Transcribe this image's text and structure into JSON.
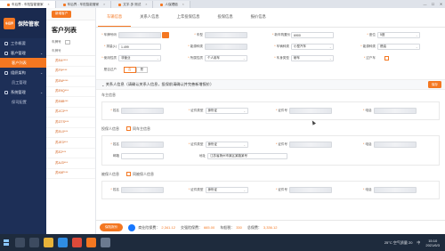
{
  "browser": {
    "tabs": [
      {
        "label": "车后界 - 车险智能管家",
        "active": true
      },
      {
        "label": "车后界 - 车险智能管家",
        "active": false
      },
      {
        "label": "文字-多 测试",
        "active": false
      },
      {
        "label": "人保理赔",
        "active": false
      }
    ],
    "window_controls": [
      "—",
      "☐",
      "✕"
    ]
  },
  "app": {
    "logo_mark": "车后界",
    "logo_text": "保险管家",
    "accent": "#f47721",
    "sidebar_bg": "#1d2f57"
  },
  "sidebar": {
    "items": [
      {
        "label": "工作概要",
        "type": "item"
      },
      {
        "label": "客户管理",
        "type": "group"
      },
      {
        "label": "客户列表",
        "type": "sub",
        "active": true
      },
      {
        "label": "组织架构",
        "type": "group"
      },
      {
        "label": "员工管理",
        "type": "sub"
      },
      {
        "label": "系统管理",
        "type": "group"
      },
      {
        "label": "保司配置",
        "type": "sub"
      }
    ]
  },
  "list": {
    "add_button": "新增客户",
    "title": "客户列表",
    "filter_label": "车牌号",
    "column_header": "车牌号",
    "plates": [
      "苏EA****",
      "苏F9****",
      "苏EM****",
      "苏E9Q***",
      "苏E8B***",
      "苏JC3***",
      "苏GTS***",
      "苏EL0***",
      "苏JE3***",
      "苏E2***",
      "苏AJ3***",
      "苏K6F***"
    ]
  },
  "detail": {
    "tabs": [
      {
        "label": "车辆信息",
        "active": true
      },
      {
        "label": "关系人信息",
        "active": false
      },
      {
        "label": "上年投保信息",
        "active": false
      },
      {
        "label": "投保信息",
        "active": false
      },
      {
        "label": "报价信息",
        "active": false
      }
    ],
    "vehicle_rows": [
      [
        {
          "label": "车牌号码",
          "req": true,
          "value": "",
          "blur": true,
          "action": true
        },
        {
          "label": "车型",
          "req": true,
          "value": "",
          "blur": true
        },
        {
          "label": "新车购置价",
          "req": true,
          "value": "6900",
          "blur": false
        },
        {
          "label": "座位",
          "req": true,
          "value": "5座",
          "dropdown": true
        }
      ],
      [
        {
          "label": "排量(L)",
          "req": true,
          "value": "1.499"
        },
        {
          "label": "能源种类",
          "req": true,
          "value": "",
          "blur": true
        },
        {
          "label": "车辆种类",
          "req": true,
          "value": "小型汽车",
          "dropdown": true
        },
        {
          "label": "能源种类",
          "req": true,
          "value": "燃油",
          "dropdown": true
        }
      ],
      [
        {
          "label": "使用性质",
          "req": true,
          "value": "非营业",
          "dropdown": true
        },
        {
          "label": "所属性质",
          "req": true,
          "value": "个人用车",
          "dropdown": true
        },
        {
          "label": "车身类型",
          "req": true,
          "value": "轿车",
          "dropdown": true
        },
        {
          "label": "过户车",
          "req": true,
          "value": "",
          "checkbox": true
        }
      ]
    ],
    "vehicle_flag": {
      "label": "是否过户",
      "options": [
        "否",
        "是"
      ],
      "selected": "否"
    },
    "relations": {
      "section_title": "关系人信息（请确认关系人信息，投保前请确认并完善新增报价）",
      "section_button": "保存",
      "owner": {
        "title": "车主信息",
        "name_label": "姓名",
        "idtype_label": "证件类型",
        "idtype_value": "身份证",
        "idno_label": "证件号",
        "phone_label": "电话"
      },
      "insured": {
        "title": "投保人信息",
        "same_as_owner": "同车主信息",
        "name_label": "姓名",
        "idtype_label": "证件类型",
        "idtype_value": "身份证",
        "idno_label": "证件号",
        "phone_label": "电话",
        "email_label": "邮箱",
        "addr_label": "地址",
        "addr_value": "江苏省扬州市某区某路某号",
        "email_value": ""
      },
      "beneficiary": {
        "title": "被保人信息",
        "same_as_owner": "同被保人信息",
        "name_label": "姓名",
        "idtype_label": "证件类型",
        "idtype_value": "身份证",
        "idno_label": "证件号",
        "phone_label": "电话"
      }
    }
  },
  "stats": {
    "button": "保险报价",
    "premium_label": "商业险保费：",
    "premium_value": "2,341.12",
    "compulsory_label": "交强险保费：",
    "compulsory_value": "665.00",
    "tax_label": "车船税：",
    "tax_value": "330",
    "total_label": "总保费：",
    "total_value": "3,336.12"
  },
  "taskbar": {
    "icons": [
      {
        "name": "search-icon",
        "color": "#3d4b60"
      },
      {
        "name": "taskview-icon",
        "color": "#3d4b60"
      },
      {
        "name": "explorer-icon",
        "color": "#e8b339"
      },
      {
        "name": "browser-icon",
        "color": "#2f8de4"
      },
      {
        "name": "chrome-icon",
        "color": "#de4a3a"
      },
      {
        "name": "app-orange-icon",
        "color": "#f47721"
      },
      {
        "name": "settings-icon",
        "color": "#6b7a90"
      }
    ],
    "weather": "25°C 空气质量 20",
    "lang": "中",
    "time": "15:10",
    "date": "2021/6/3"
  }
}
